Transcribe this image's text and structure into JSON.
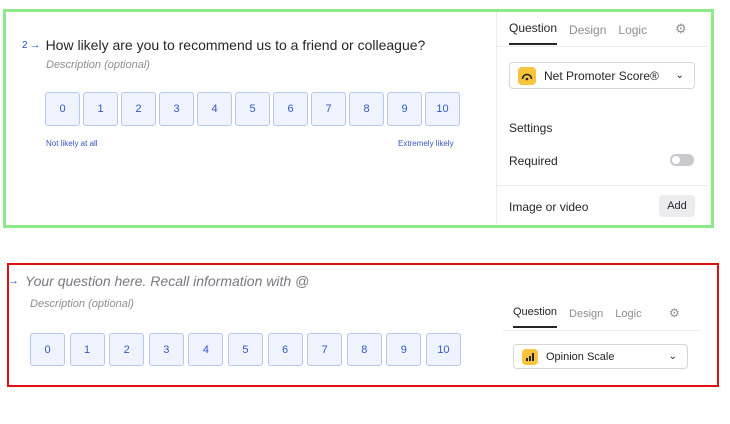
{
  "colors": {
    "accent": "#1f53c6",
    "success_frame": "#8ee98a",
    "error_frame": "#e00f10",
    "icon_yellow": "#f7c43c"
  },
  "top": {
    "question_number": "2",
    "question_title": "How likely are you to recommend us to a friend or colleague?",
    "description_placeholder": "Description (optional)",
    "scale": [
      "0",
      "1",
      "2",
      "3",
      "4",
      "5",
      "6",
      "7",
      "8",
      "9",
      "10"
    ],
    "label_low": "Not likely at all",
    "label_high": "Extremely likely",
    "panel": {
      "tabs": [
        "Question",
        "Design",
        "Logic"
      ],
      "active_tab": "Question",
      "gear_icon": "gear-icon",
      "question_type": "Net Promoter Score®",
      "question_type_icon": "nps-gauge-icon",
      "settings_heading": "Settings",
      "required_label": "Required",
      "required_enabled": false,
      "image_label": "Image or video",
      "add_label": "Add"
    }
  },
  "bottom": {
    "question_title_placeholder": "Your question here. Recall information with @",
    "description_placeholder": "Description (optional)",
    "scale": [
      "0",
      "1",
      "2",
      "3",
      "4",
      "5",
      "6",
      "7",
      "8",
      "9",
      "10"
    ],
    "panel": {
      "tabs": [
        "Question",
        "Design",
        "Logic"
      ],
      "active_tab": "Question",
      "gear_icon": "gear-icon",
      "question_type": "Opinion Scale",
      "question_type_icon": "bar-chart-icon"
    }
  }
}
